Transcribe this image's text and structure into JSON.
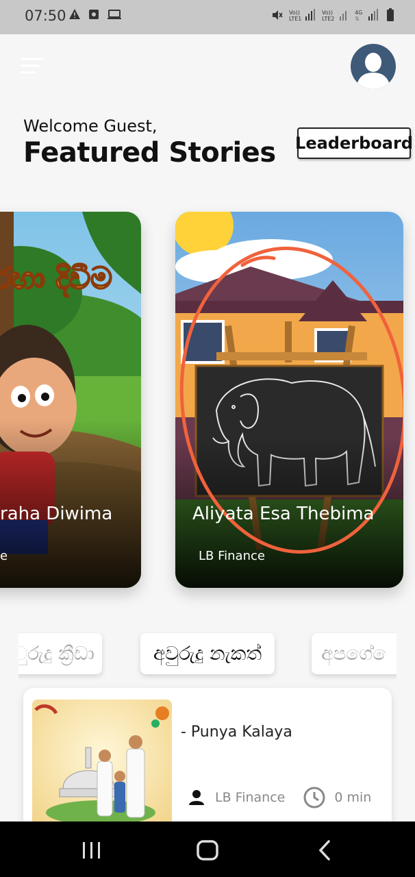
{
  "status_bar": {
    "time": "07:50"
  },
  "header": {
    "welcome": "Welcome Guest,",
    "title": "Featured Stories",
    "leaderboard_label": "Leaderboard"
  },
  "cards": [
    {
      "title": "raha Diwima",
      "author": "e",
      "art_text": "රහා දිවීම"
    },
    {
      "title": "Aliyata Esa Thebima",
      "author": "LB Finance"
    }
  ],
  "categories": [
    "ුරුදු ක්‍රීඩා",
    "අවුරුදු නැකත්",
    "අපගේ ෙ"
  ],
  "story": {
    "title": "- Punya Kalaya",
    "author": "LB Finance",
    "duration": "0 min"
  },
  "colors": {
    "annotation": "#f0623c",
    "status_bar_bg": "#c8c8c8",
    "nav_bar_bg": "#000000"
  }
}
